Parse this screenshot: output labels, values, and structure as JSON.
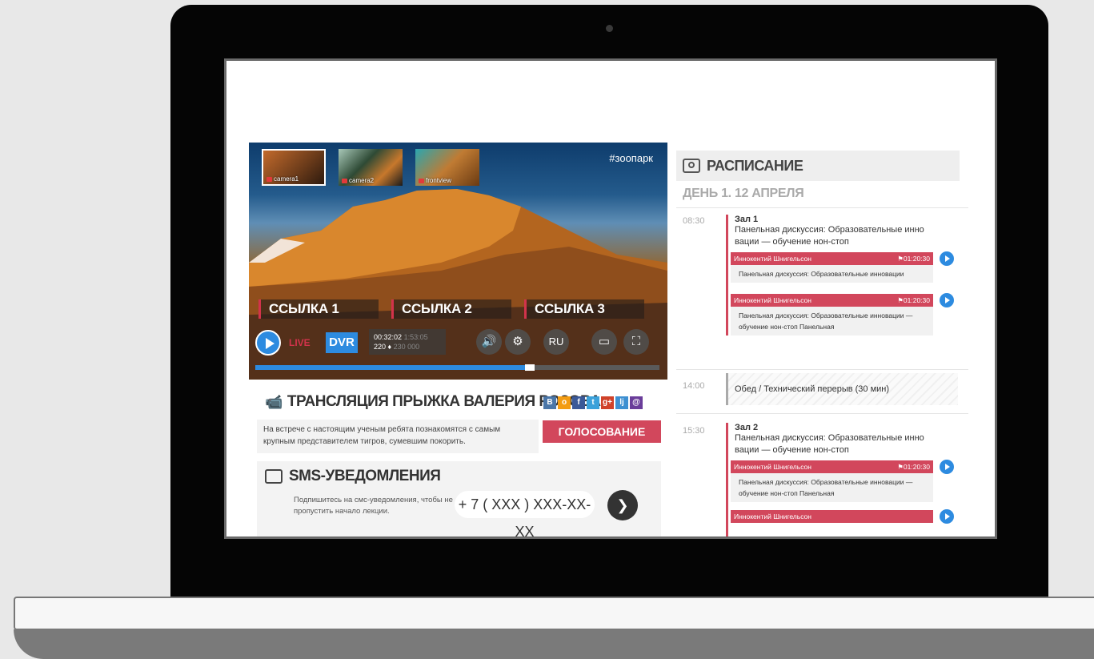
{
  "player": {
    "cameras": [
      {
        "label": "camera1",
        "active": true
      },
      {
        "label": "camera2",
        "active": false
      },
      {
        "label": "frontview",
        "active": false
      }
    ],
    "hashtag": "#зоопарк",
    "links": [
      "ССЫЛКА 1",
      "ССЫЛКА 2",
      "ССЫЛКА 3"
    ],
    "live_label": "LIVE",
    "dvr_label": "DVR",
    "stats": {
      "time": "00:32:02",
      "time_total": "1:53:05",
      "viewers": "220",
      "viewers_total": "230 000"
    },
    "lang_label": "RU",
    "progress": 0.68
  },
  "broadcast": {
    "title": "ТРАНСЛЯЦИЯ ПРЫЖКА ВАЛЕРИЯ РОЗОВА",
    "description": "На встрече с настоящим ученым ребята познакомятся с самым крупным представителем тигров, сумевшим покорить.",
    "vote_label": "ГОЛОСОВАНИЕ",
    "share": [
      {
        "name": "vk-icon",
        "glyph": "B",
        "color": "#4a76a8"
      },
      {
        "name": "ok-icon",
        "glyph": "o",
        "color": "#f39c12"
      },
      {
        "name": "facebook-icon",
        "glyph": "f",
        "color": "#3b5998"
      },
      {
        "name": "twitter-icon",
        "glyph": "t",
        "color": "#3ba1da"
      },
      {
        "name": "gplus-icon",
        "glyph": "g+",
        "color": "#d0422a"
      },
      {
        "name": "livejournal-icon",
        "glyph": "lj",
        "color": "#3d8fd1"
      },
      {
        "name": "mail-icon",
        "glyph": "@",
        "color": "#6a3d9a"
      }
    ]
  },
  "sms": {
    "title": "SMS-УВЕДОМЛЕНИЯ",
    "hint": "Подпишитесь на смс-уведомления, чтобы не пропустить начало лекции.",
    "phone_placeholder": "+ 7 ( XXX ) XXX-XX-XX"
  },
  "schedule": {
    "title": "РАСПИСАНИЕ",
    "day": "ДЕНЬ 1.  12 АПРЕЛЯ",
    "slots": [
      {
        "time": "08:30",
        "hall": "Зал 1",
        "desc": "Панельная дискуссия: Образовательные инно вации — обучение нон-стоп",
        "talks": [
          {
            "speaker": "Иннокентий Шнигельсон",
            "duration": "01:20:30",
            "text": "Панельная дискуссия: Образовательные инновации"
          },
          {
            "speaker": "Иннокентий Шнигельсон",
            "duration": "01:20:30",
            "text": "Панельная дискуссия: Образовательные инновации — обучение нон-стоп Панельная"
          }
        ]
      },
      {
        "time": "14:00",
        "break": "Обед / Технический перерыв (30 мин)"
      },
      {
        "time": "15:30",
        "hall": "Зал 2",
        "desc": "Панельная дискуссия: Образовательные инно вации — обучение нон-стоп",
        "talks": [
          {
            "speaker": "Иннокентий Шнигельсон",
            "duration": "01:20:30",
            "text": "Панельная дискуссия: Образовательные инновации — обучение нон-стоп Панельная"
          },
          {
            "speaker": "Иннокентий Шнигельсон",
            "duration": "",
            "text": ""
          }
        ]
      }
    ]
  }
}
